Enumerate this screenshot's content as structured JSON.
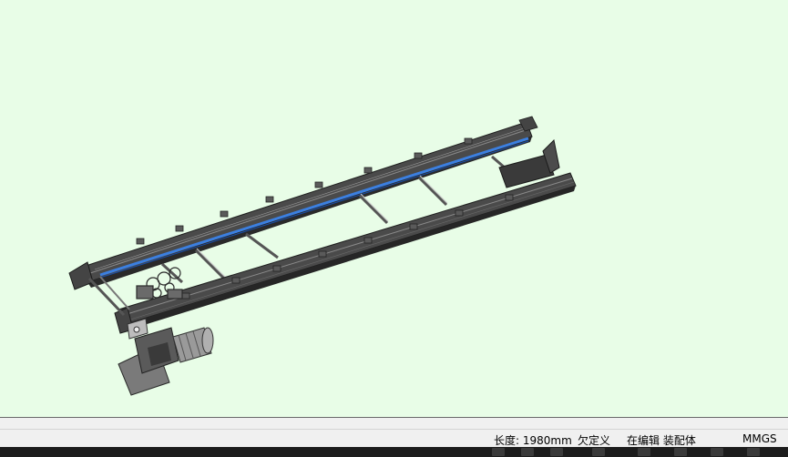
{
  "status": {
    "length": "长度: 1980mm",
    "constraint": "欠定义",
    "mode": "在编辑 装配体",
    "units": "MMGS"
  },
  "colors": {
    "background": "#e8fde7",
    "frame": "#3c3c3c",
    "belt_accent": "#3b7fe0",
    "statusbar": "#f0f0f0"
  },
  "viewport": {
    "model": "conveyor-assembly"
  }
}
